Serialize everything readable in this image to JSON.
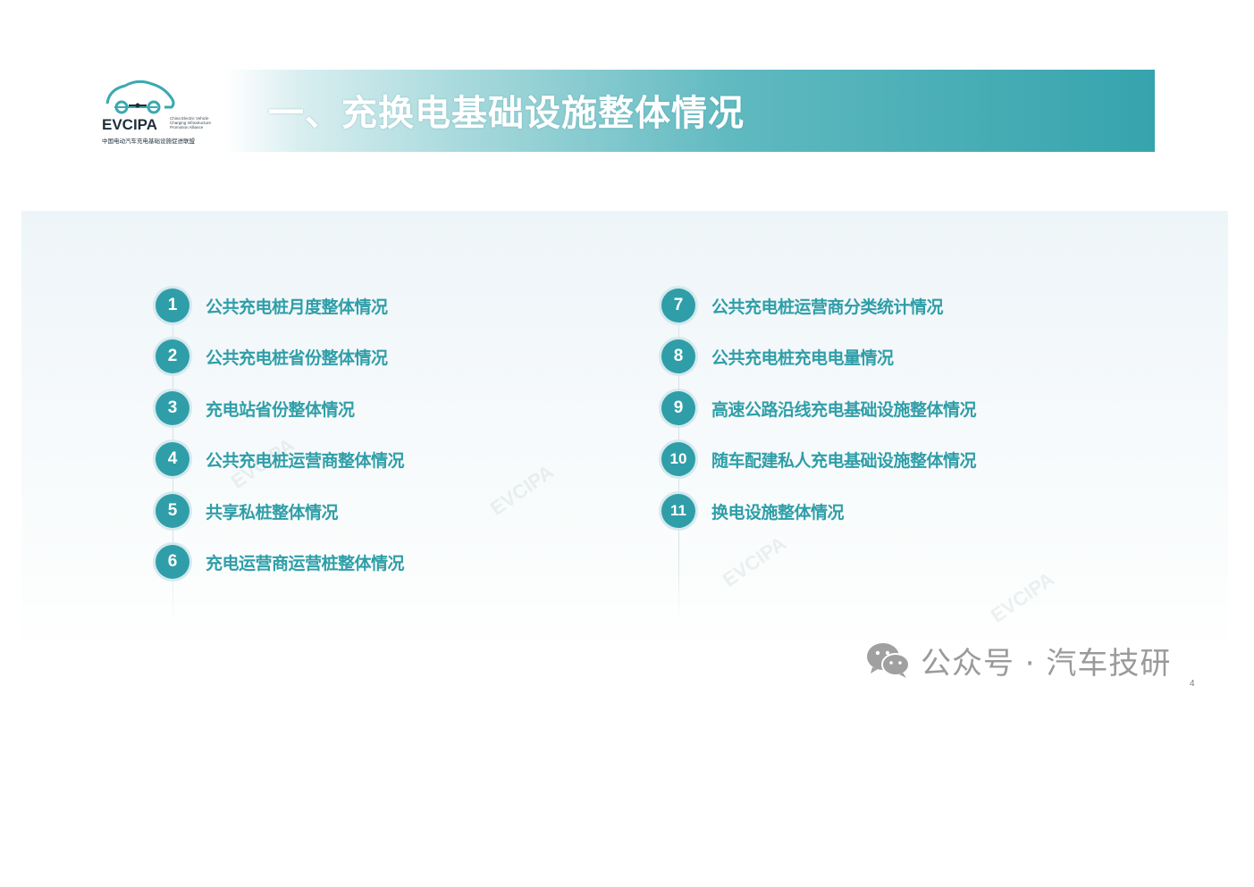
{
  "logo": {
    "main": "EVCIPA",
    "sub_en": "China Electric Vehicle Charging Infrastructure Promotion Alliance",
    "sub_cn": "中国电动汽车充电基础设施促进联盟"
  },
  "title": "一、充换电基础设施整体情况",
  "items_left": [
    {
      "num": "1",
      "label": "公共充电桩月度整体情况"
    },
    {
      "num": "2",
      "label": "公共充电桩省份整体情况"
    },
    {
      "num": "3",
      "label": "充电站省份整体情况"
    },
    {
      "num": "4",
      "label": "公共充电桩运营商整体情况"
    },
    {
      "num": "5",
      "label": "共享私桩整体情况"
    },
    {
      "num": "6",
      "label": "充电运营商运营桩整体情况"
    }
  ],
  "items_right": [
    {
      "num": "7",
      "label": "公共充电桩运营商分类统计情况"
    },
    {
      "num": "8",
      "label": "公共充电桩充电电量情况"
    },
    {
      "num": "9",
      "label": "高速公路沿线充电基础设施整体情况"
    },
    {
      "num": "10",
      "label": "随车配建私人充电基础设施整体情况"
    },
    {
      "num": "11",
      "label": "换电设施整体情况"
    }
  ],
  "watermark": {
    "icon": "wechat-icon",
    "text": "公众号 · 汽车技研"
  },
  "page_number": "4",
  "colors": {
    "accent": "#2f9ea8",
    "banner_end": "#36a4ad",
    "watermark_gray": "#9a9a9a"
  }
}
